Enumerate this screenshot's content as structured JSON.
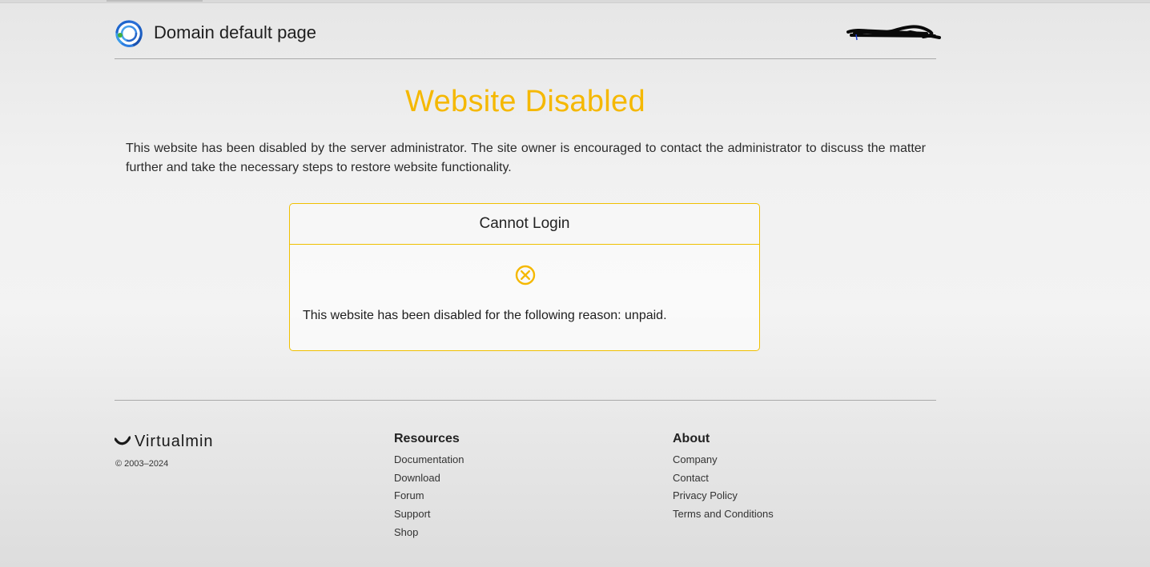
{
  "header": {
    "title": "Domain default page",
    "logo_icon": "virtualmin-swirl-logo",
    "redacted_text": "(redacted)"
  },
  "main": {
    "heading": "Website Disabled",
    "intro": "This website has been disabled by the server administrator. The site owner is encouraged to contact the administrator to discuss the matter further and take the necessary steps to restore website functionality.",
    "card": {
      "title": "Cannot Login",
      "icon": "circle-x-icon",
      "message": "This website has been disabled for the following reason: unpaid."
    }
  },
  "footer": {
    "brand": "Virtualmin",
    "copyright": "© 2003–2024",
    "resources": {
      "heading": "Resources",
      "links": [
        "Documentation",
        "Download",
        "Forum",
        "Support",
        "Shop"
      ]
    },
    "about": {
      "heading": "About",
      "links": [
        "Company",
        "Contact",
        "Privacy Policy",
        "Terms and Conditions"
      ]
    }
  },
  "colors": {
    "accent": "#f5b800",
    "border": "#f0c000",
    "text": "#212529"
  }
}
